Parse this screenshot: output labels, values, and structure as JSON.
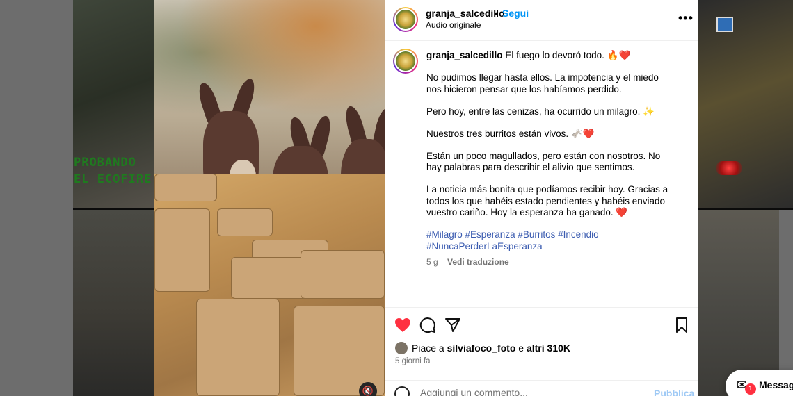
{
  "background": {
    "overlay_text": "PROBANDO EL ECOFIRE"
  },
  "post": {
    "header": {
      "username": "granja_salcedillo",
      "separator": "•",
      "follow_label": "Segui",
      "audio_label": "Audio originale",
      "more_icon": "more-horizontal-icon"
    },
    "caption": {
      "username": "granja_salcedillo",
      "first_line": "El fuego lo devoró todo. 🔥❤️",
      "paragraphs": [
        "No pudimos llegar hasta ellos. La impotencia y el miedo nos hicieron pensar que los habíamos perdido.",
        "Pero hoy, entre las cenizas, ha ocurrido un milagro. ✨",
        "Nuestros tres burritos están vivos. 🫏❤️",
        "Están un poco magullados, pero están con nosotros. No hay palabras para describir el alivio que sentimos.",
        "La noticia más bonita que podíamos recibir hoy. Gracias a todos los que habéis estado pendientes y habéis enviado vuestro cariño. Hoy la esperanza ha ganado. ❤️"
      ],
      "hashtags": "#Milagro #Esperanza #Burritos #Incendio #NuncaPerderLaEsperanza",
      "age": "5 g",
      "translate_label": "Vedi traduzione"
    },
    "actions": {
      "liked": true,
      "like_color": "#ff3040",
      "likes_prefix": "Piace a",
      "likes_user": "silviafoco_foto",
      "likes_middle": "e",
      "likes_others": "altri 310K",
      "time_ago": "5 giorni fa"
    },
    "comment": {
      "placeholder": "Aggiungi un commento...",
      "publish_label": "Pubblica"
    }
  },
  "messages": {
    "label": "Messaggi",
    "badge": "1"
  }
}
